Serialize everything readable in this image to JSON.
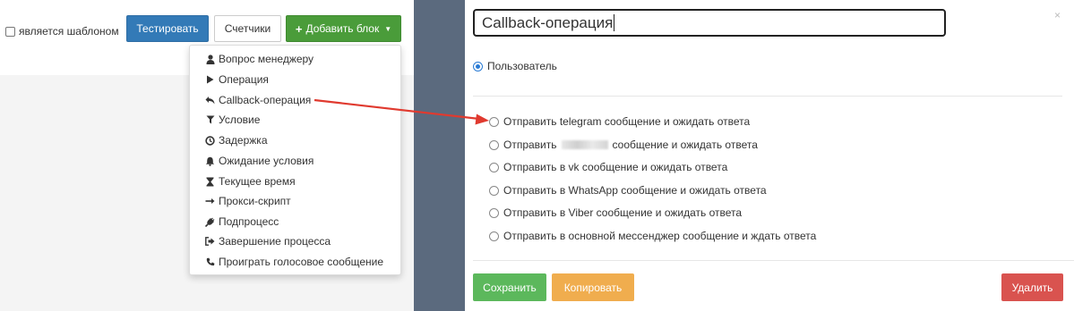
{
  "toolbar": {
    "is_template_label": "является шаблоном",
    "test_label": "Тестировать",
    "counters_label": "Счетчики",
    "add_block_label": "Добавить блок"
  },
  "menu": {
    "items": [
      {
        "label": "Вопрос менеджеру",
        "icon": "user-icon"
      },
      {
        "label": "Операция",
        "icon": "play-icon"
      },
      {
        "label": "Callback-операция",
        "icon": "reply-icon"
      },
      {
        "label": "Условие",
        "icon": "filter-icon"
      },
      {
        "label": "Задержка",
        "icon": "clock-icon"
      },
      {
        "label": "Ожидание условия",
        "icon": "bell-icon"
      },
      {
        "label": "Текущее время",
        "icon": "hourglass-icon"
      },
      {
        "label": "Прокси-скрипт",
        "icon": "long-arrow-icon"
      },
      {
        "label": "Подпроцесс",
        "icon": "plug-icon"
      },
      {
        "label": "Завершение процесса",
        "icon": "sign-out-icon"
      },
      {
        "label": "Проиграть голосовое сообщение",
        "icon": "phone-icon"
      }
    ]
  },
  "dialog": {
    "title_value": "Callback-операция",
    "close_symbol": "×",
    "user_option": "Пользователь",
    "options": [
      "Отправить telegram сообщение и ожидать ответа",
      "Отправить",
      "сообщение и ожидать ответа",
      "Отправить в vk сообщение и ожидать ответа",
      "Отправить в WhatsApp сообщение и ожидать ответа",
      "Отправить в Viber сообщение и ожидать ответа",
      "Отправить в основной мессенджер сообщение и ждать ответа"
    ],
    "save_label": "Сохранить",
    "copy_label": "Копировать",
    "delete_label": "Удалить"
  },
  "colors": {
    "primary": "#337ab7",
    "success": "#4a9c3a",
    "save": "#5cb85c",
    "copy": "#f0ad4e",
    "delete": "#d9534f",
    "annotation_arrow": "#e03a2f",
    "divider": "#5b6a7e"
  }
}
